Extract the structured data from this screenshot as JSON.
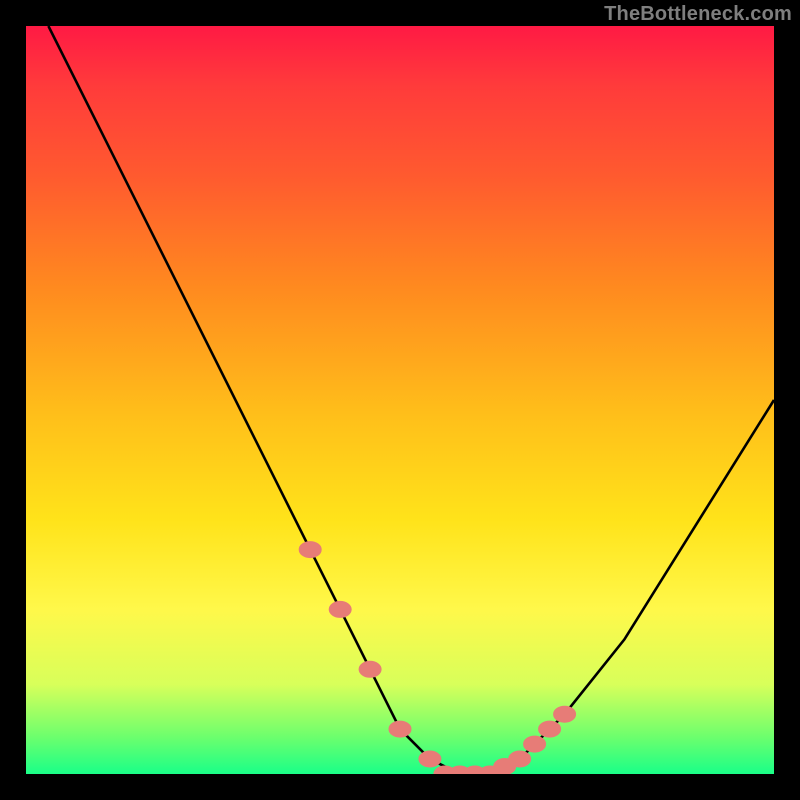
{
  "watermark": "TheBottleneck.com",
  "colors": {
    "page_bg": "#000000",
    "curve": "#000000",
    "marker_fill": "#e77c77",
    "marker_stroke": "#e77c77",
    "gradient_top": "#ff1a44",
    "gradient_bottom": "#1aff88"
  },
  "chart_data": {
    "type": "line",
    "title": "",
    "xlabel": "",
    "ylabel": "",
    "xlim": [
      0,
      100
    ],
    "ylim": [
      0,
      100
    ],
    "grid": false,
    "legend": false,
    "series": [
      {
        "name": "curve",
        "x": [
          3,
          10,
          20,
          30,
          38,
          42,
          46,
          50,
          54,
          58,
          62,
          66,
          72,
          80,
          90,
          100
        ],
        "y": [
          100,
          86,
          66,
          46,
          30,
          22,
          14,
          6,
          2,
          0,
          0,
          2,
          8,
          18,
          34,
          50
        ]
      }
    ],
    "markers": [
      {
        "x": 38,
        "y": 30
      },
      {
        "x": 42,
        "y": 22
      },
      {
        "x": 46,
        "y": 14
      },
      {
        "x": 50,
        "y": 6
      },
      {
        "x": 54,
        "y": 2
      },
      {
        "x": 56,
        "y": 0
      },
      {
        "x": 58,
        "y": 0
      },
      {
        "x": 60,
        "y": 0
      },
      {
        "x": 62,
        "y": 0
      },
      {
        "x": 64,
        "y": 1
      },
      {
        "x": 66,
        "y": 2
      },
      {
        "x": 68,
        "y": 4
      },
      {
        "x": 70,
        "y": 6
      },
      {
        "x": 72,
        "y": 8
      }
    ]
  }
}
